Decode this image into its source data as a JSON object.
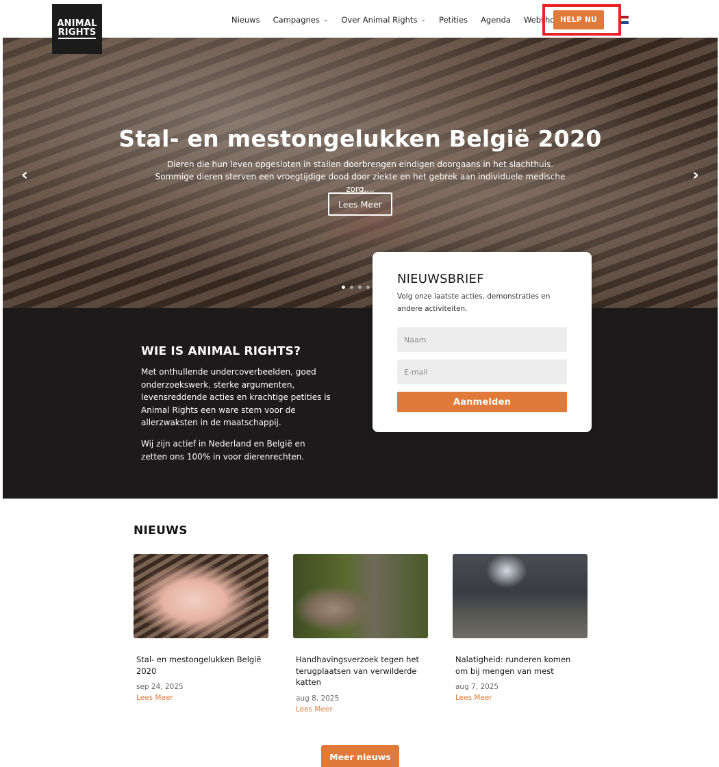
{
  "header": {
    "logo_line1": "ANIMAL",
    "logo_line2": "RIGHTS",
    "nav": [
      {
        "label": "Nieuws"
      },
      {
        "label": "Campagnes"
      },
      {
        "label": "Over Animal Rights"
      },
      {
        "label": "Petities"
      },
      {
        "label": "Agenda"
      },
      {
        "label": "Webshop"
      }
    ],
    "help_label": "HELP NU",
    "chevron": "⌄"
  },
  "hero": {
    "title": "Stal- en mestongelukken België 2020",
    "text": "Dieren die hun leven opgesloten in stallen doorbrengen eindigen doorgaans in het slachthuis. Sommige dieren sterven een vroegtijdige dood door ziekte en het gebrek aan individuele medische zorg,...",
    "button": "Lees Meer",
    "arrow_left": "‹",
    "arrow_right": "›",
    "slides": 4,
    "active_slide": 1
  },
  "about": {
    "title": "WIE IS ANIMAL RIGHTS?",
    "p1": "Met onthullende undercoverbeelden, goed onderzoekswerk, sterke argumenten, levensreddende acties en krachtige petities is Animal Rights een ware stem voor de allerzwaksten in de maatschappij.",
    "p2": "Wij zijn actief in Nederland en België en zetten ons 100% in voor dierenrechten."
  },
  "newsletter": {
    "title": "NIEUWSBRIEF",
    "text": "Volg onze laatste acties, demonstraties en andere activiteiten.",
    "name_placeholder": "Naam",
    "email_placeholder": "E-mail",
    "submit": "Aanmelden"
  },
  "news": {
    "title": "NIEUWS",
    "items": [
      {
        "title": "Stal- en mestongelukken België 2020",
        "date": "sep 24, 2025",
        "link": "Lees Meer"
      },
      {
        "title": "Handhavingsverzoek tegen het terugplaatsen van verwilderde katten",
        "date": "aug 8, 2025",
        "link": "Lees Meer"
      },
      {
        "title": "Nalatigheid: runderen komen om bij mengen van mest",
        "date": "aug 7, 2025",
        "link": "Lees Meer"
      }
    ],
    "more": "Meer nieuws"
  },
  "colors": {
    "accent": "#e07a3a",
    "dark": "#1c1a1a",
    "highlight": "#e8232a"
  }
}
